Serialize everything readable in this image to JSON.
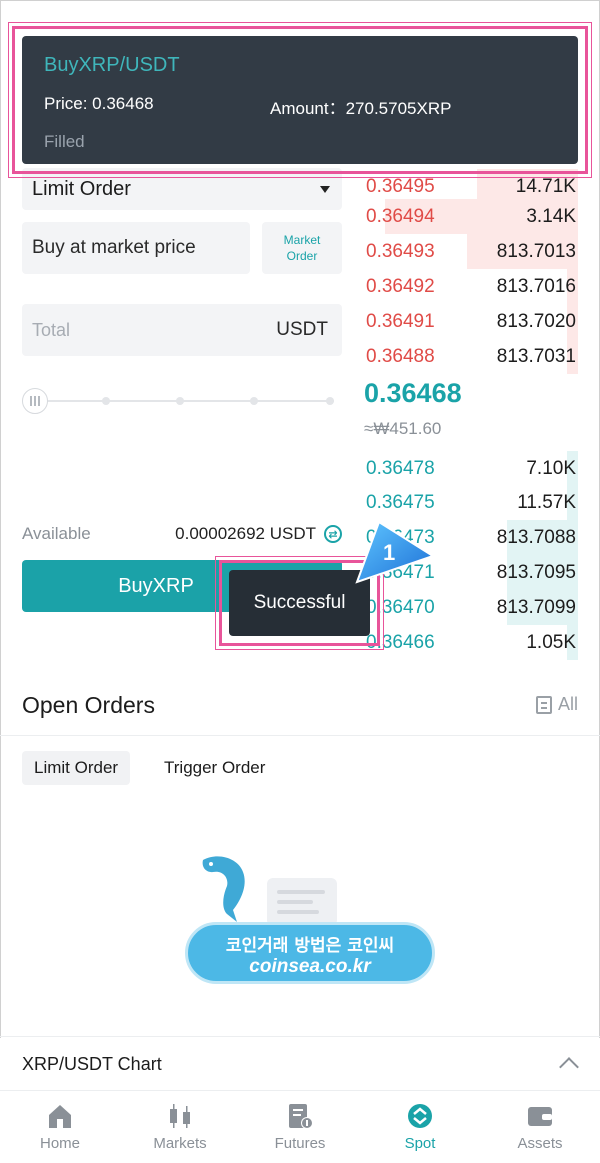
{
  "notification": {
    "pair": "BuyXRP/USDT",
    "price": "Price: 0.36468",
    "amount": "Amount：270.5705XRP",
    "status": "Filled"
  },
  "form": {
    "order_type": "Limit Order",
    "price_value": "Buy at market price",
    "market_order_label": "Market Order",
    "total_placeholder": "Total",
    "total_unit": "USDT",
    "available_label": "Available",
    "available_value": "0.00002692 USDT",
    "buy_label": "BuyXRP"
  },
  "toast": {
    "text": "Successful"
  },
  "callout": {
    "number": "1"
  },
  "order_book": {
    "asks": [
      {
        "price": "0.36495",
        "qty": "14.71K",
        "depth": 0.47
      },
      {
        "price": "0.36494",
        "qty": "3.14K",
        "depth": 0.9
      },
      {
        "price": "0.36493",
        "qty": "813.7013",
        "depth": 0.52
      },
      {
        "price": "0.36492",
        "qty": "813.7016",
        "depth": 0.05
      },
      {
        "price": "0.36491",
        "qty": "813.7020",
        "depth": 0.05
      },
      {
        "price": "0.36488",
        "qty": "813.7031",
        "depth": 0.05
      }
    ],
    "last_price": "0.36468",
    "last_price_fiat": "≈₩451.60",
    "bids": [
      {
        "price": "0.36478",
        "qty": "7.10K",
        "depth": 0.05
      },
      {
        "price": "0.36475",
        "qty": "11.57K",
        "depth": 0.05
      },
      {
        "price": "0.36473",
        "qty": "813.7088",
        "depth": 0.33
      },
      {
        "price": "0.36471",
        "qty": "813.7095",
        "depth": 0.33
      },
      {
        "price": "0.36470",
        "qty": "813.7099",
        "depth": 0.33
      },
      {
        "price": "0.36466",
        "qty": "1.05K",
        "depth": 0.05
      }
    ]
  },
  "open_orders": {
    "title": "Open Orders",
    "all_label": "All",
    "tabs": [
      "Limit Order",
      "Trigger Order"
    ]
  },
  "watermark": {
    "korean": "코인거래 방법은 코인씨",
    "english": "coinsea.co.kr"
  },
  "chart_section": {
    "title": "XRP/USDT Chart"
  },
  "nav": [
    {
      "label": "Home",
      "icon": "home-icon"
    },
    {
      "label": "Markets",
      "icon": "candlestick-icon"
    },
    {
      "label": "Futures",
      "icon": "futures-icon"
    },
    {
      "label": "Spot",
      "icon": "spot-icon"
    },
    {
      "label": "Assets",
      "icon": "wallet-icon"
    }
  ],
  "colors": {
    "accent": "#1aa3a8",
    "ask": "#e04b47",
    "highlight": "#e8549a",
    "toast_bg": "#323b45"
  }
}
